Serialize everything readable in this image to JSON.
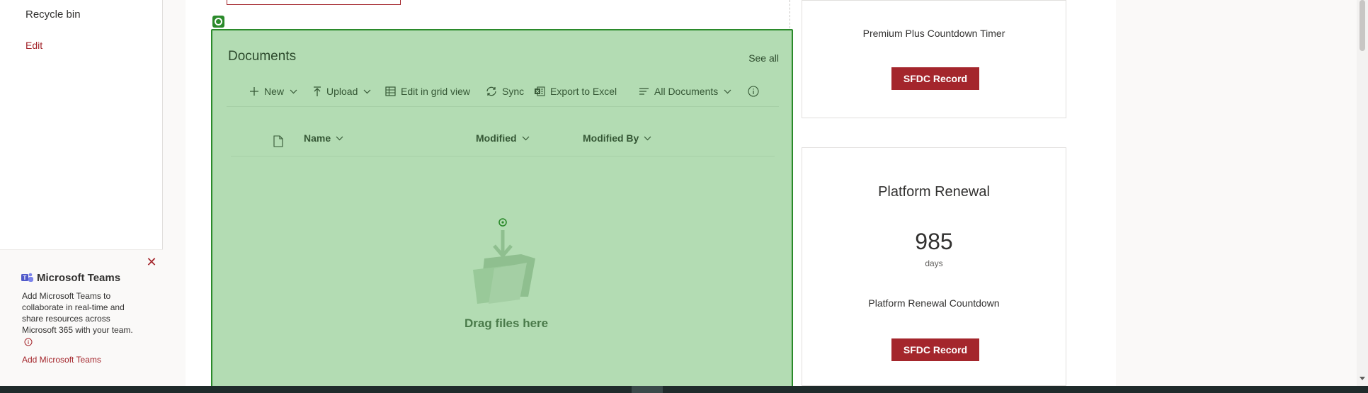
{
  "nav": {
    "recycle_bin": "Recycle bin",
    "edit": "Edit"
  },
  "teams_panel": {
    "title": "Microsoft Teams",
    "description": "Add Microsoft Teams to collaborate in real-time and share resources across Microsoft 365 with your team.",
    "add_link": "Add Microsoft Teams",
    "close_icon": "close-icon",
    "info_icon": "info-icon"
  },
  "documents": {
    "title": "Documents",
    "see_all": "See all",
    "commands": [
      {
        "label": "New",
        "icon": "plus-icon"
      },
      {
        "label": "Upload",
        "icon": "upload-icon"
      },
      {
        "label": "Edit in grid view",
        "icon": "grid-icon"
      },
      {
        "label": "Sync",
        "icon": "sync-icon"
      },
      {
        "label": "Export to Excel",
        "icon": "excel-icon"
      },
      {
        "label": "All Documents",
        "icon": "list-view-icon"
      }
    ],
    "columns": [
      "Name",
      "Modified",
      "Modified By"
    ],
    "empty_message": "Drag files here"
  },
  "cards": [
    {
      "subtitle": "Premium Plus Countdown Timer",
      "button": "SFDC Record"
    },
    {
      "title": "Platform Renewal",
      "number": "985",
      "unit": "days",
      "subtitle": "Platform Renewal Countdown",
      "button": "SFDC Record"
    }
  ],
  "colors": {
    "accent": "#a4262c",
    "selection_fill": "#b3dcb3",
    "selection_border": "#2b8a2b"
  }
}
